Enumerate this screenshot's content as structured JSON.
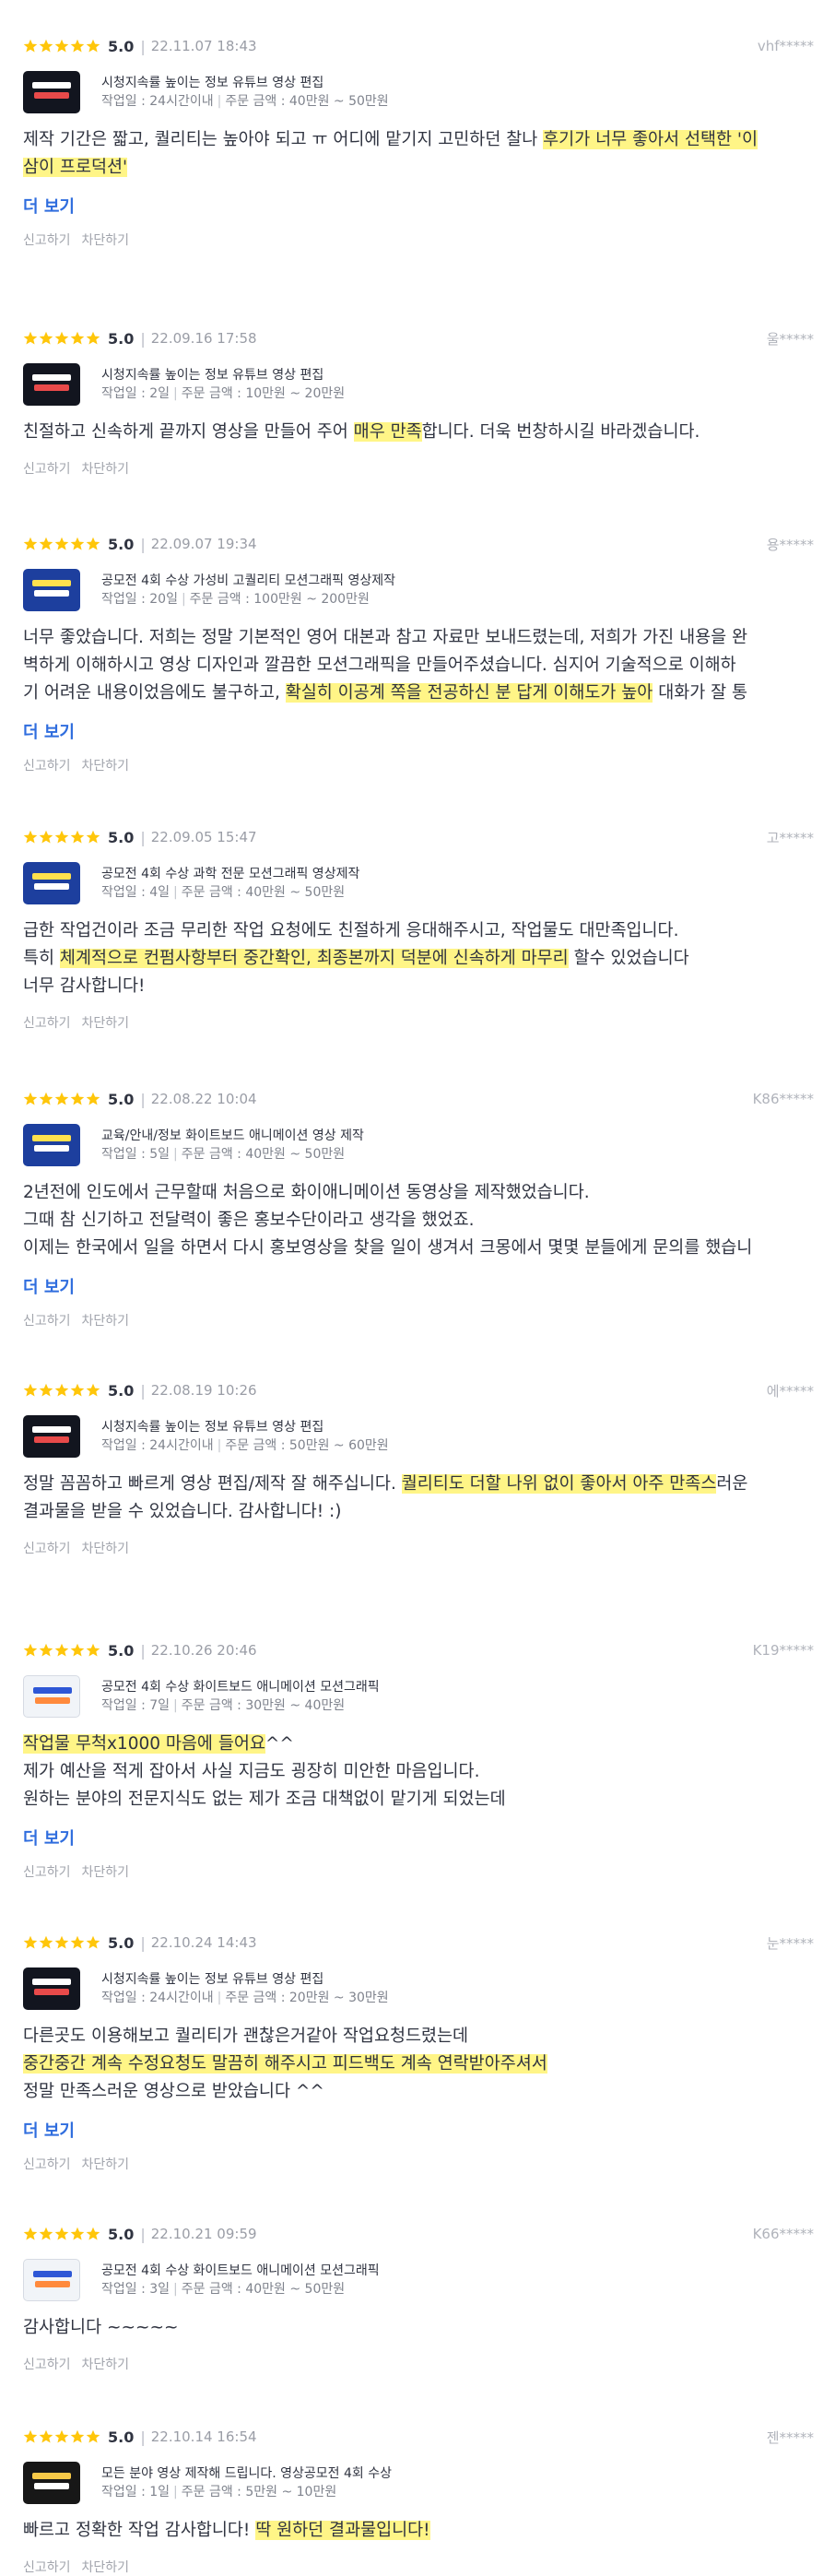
{
  "more_label": "더 보기",
  "report_label": "신고하기",
  "block_label": "차단하기",
  "star_color": "#ffc60a",
  "highlight_color": "#fff587",
  "reviews": [
    {
      "score": "5.0",
      "date": "22.11.07 18:43",
      "user": "vhf*****",
      "gig_title": "시청지속률 높이는 정보 유튜브 영상 편집",
      "work_days": "작업일 : 24시간이내",
      "price": "주문 금액 : 40만원 ~ 50만원",
      "thumb": "dark",
      "has_more": true,
      "lines": [
        [
          {
            "t": "제작 기간은 짧고, 퀄리티는 높아야 되고 ㅠ 어디에 맡기지 고민하던 찰나 "
          },
          {
            "t": "후기가 너무 좋아서 선택한 '이",
            "hl": true
          }
        ],
        [
          {
            "t": "삼이 프로덕션'",
            "hl": true
          }
        ]
      ]
    },
    {
      "score": "5.0",
      "date": "22.09.16 17:58",
      "user": "울*****",
      "gig_title": "시청지속률 높이는 정보 유튜브 영상 편집",
      "work_days": "작업일 : 2일",
      "price": "주문 금액 : 10만원 ~ 20만원",
      "thumb": "dark",
      "has_more": false,
      "lines": [
        [
          {
            "t": "친절하고 신속하게 끝까지 영상을 만들어 주어 "
          },
          {
            "t": "매우 만족",
            "hl": true
          },
          {
            "t": "합니다. 더욱  번창하시길 바라겠습니다."
          }
        ]
      ]
    },
    {
      "score": "5.0",
      "date": "22.09.07 19:34",
      "user": "용*****",
      "gig_title": "공모전 4회 수상 가성비 고퀄리티 모션그래픽 영상제작",
      "work_days": "작업일 : 20일",
      "price": "주문 금액 : 100만원 ~ 200만원",
      "thumb": "blue",
      "has_more": true,
      "lines": [
        [
          {
            "t": "너무 좋았습니다. 저희는 정말 기본적인 영어 대본과 참고 자료만 보내드렸는데, 저희가 가진 내용을 완"
          }
        ],
        [
          {
            "t": "벽하게 이해하시고 영상 디자인과 깔끔한 모션그래픽을 만들어주셨습니다. 심지어 기술적으로 이해하"
          }
        ],
        [
          {
            "t": "기 어려운 내용이었음에도 불구하고, "
          },
          {
            "t": "확실히 이공계 쪽을 전공하신 분 답게 이해도가 높아",
            "hl": true
          },
          {
            "t": " 대화가 잘 통"
          }
        ]
      ]
    },
    {
      "score": "5.0",
      "date": "22.09.05 15:47",
      "user": "고*****",
      "gig_title": "공모전 4회 수상 과학 전문 모션그래픽 영상제작",
      "work_days": "작업일 : 4일",
      "price": "주문 금액 : 40만원 ~ 50만원",
      "thumb": "blue",
      "has_more": false,
      "lines": [
        [
          {
            "t": "급한 작업건이라 조금 무리한 작업 요청에도 친절하게 응대해주시고, 작업물도 대만족입니다."
          }
        ],
        [
          {
            "t": "특히 "
          },
          {
            "t": "체계적으로 컨펌사항부터 중간확인, 최종본까지 덕분에 신속하게 마무리",
            "hl": true
          },
          {
            "t": " 할수 있었습니다"
          }
        ],
        [
          {
            "t": "너무 감사합니다!"
          }
        ]
      ]
    },
    {
      "score": "5.0",
      "date": "22.08.22 10:04",
      "user": "K86*****",
      "gig_title": "교육/안내/정보 화이트보드 애니메이션 영상 제작",
      "work_days": "작업일 : 5일",
      "price": "주문 금액 : 40만원 ~ 50만원",
      "thumb": "blue",
      "has_more": true,
      "lines": [
        [
          {
            "t": "2년전에 인도에서 근무할때 처음으로 화이애니메이션 동영상을 제작했었습니다."
          }
        ],
        [
          {
            "t": "그때 참 신기하고 전달력이 좋은 홍보수단이라고 생각을 했었죠."
          }
        ],
        [
          {
            "t": "이제는 한국에서 일을 하면서 다시 홍보영상을 찾을 일이 생겨서 크몽에서 몇몇 분들에게 문의를 했습니"
          }
        ]
      ]
    },
    {
      "score": "5.0",
      "date": "22.08.19 10:26",
      "user": "에*****",
      "gig_title": "시청지속률 높이는 정보 유튜브 영상 편집",
      "work_days": "작업일 : 24시간이내",
      "price": "주문 금액 : 50만원 ~ 60만원",
      "thumb": "dark",
      "has_more": false,
      "lines": [
        [
          {
            "t": "정말 꼼꼼하고 빠르게 영상 편집/제작 잘 해주십니다. "
          },
          {
            "t": "퀄리티도 더할 나위 없이 좋아서 아주 만족스",
            "hl": true
          },
          {
            "t": "러운"
          }
        ],
        [
          {
            "t": "결과물을 받을 수 있었습니다. 감사합니다! :)"
          }
        ]
      ]
    },
    {
      "score": "5.0",
      "date": "22.10.26 20:46",
      "user": "K19*****",
      "gig_title": "공모전 4회 수상 화이트보드 애니메이션 모션그래픽",
      "work_days": "작업일 : 7일",
      "price": "주문 금액 : 30만원 ~ 40만원",
      "thumb": "wb",
      "has_more": true,
      "lines": [
        [
          {
            "t": "작업물 무척x1000 마음에 들어요",
            "hl": true
          },
          {
            "t": "^^"
          }
        ],
        [
          {
            "t": "제가 예산을 적게 잡아서 사실 지금도 굉장히 미안한 마음입니다."
          }
        ],
        [
          {
            "t": "원하는 분야의 전문지식도 없는 제가 조금 대책없이 맡기게 되었는데"
          }
        ]
      ]
    },
    {
      "score": "5.0",
      "date": "22.10.24 14:43",
      "user": "눈*****",
      "gig_title": "시청지속률 높이는 정보 유튜브 영상 편집",
      "work_days": "작업일 : 24시간이내",
      "price": "주문 금액 : 20만원 ~ 30만원",
      "thumb": "dark",
      "has_more": true,
      "lines": [
        [
          {
            "t": "다른곳도 이용해보고 퀄리티가 괜찮은거같아 작업요청드렸는데"
          }
        ],
        [
          {
            "t": "중간중간 계속 수정요청도 말끔히 해주시고 피드백도 계속 연락받아주셔서",
            "hl": true
          }
        ],
        [
          {
            "t": "정말 만족스러운 영상으로 받았습니다 ^^"
          }
        ]
      ]
    },
    {
      "score": "5.0",
      "date": "22.10.21 09:59",
      "user": "K66*****",
      "gig_title": "공모전 4회 수상 화이트보드 애니메이션 모션그래픽",
      "work_days": "작업일 : 3일",
      "price": "주문 금액 : 40만원 ~ 50만원",
      "thumb": "wb",
      "has_more": false,
      "lines": [
        [
          {
            "t": "감사합니다 ~~~~~"
          }
        ]
      ]
    },
    {
      "score": "5.0",
      "date": "22.10.14 16:54",
      "user": "젠*****",
      "gig_title": "모든 분야 영상 제작해 드립니다. 영상공모전 4회 수상",
      "work_days": "작업일 : 1일",
      "price": "주문 금액 : 5만원 ~ 10만원",
      "thumb": "gold",
      "has_more": false,
      "lines": [
        [
          {
            "t": "빠르고 정확한 작업 감사합니다! "
          },
          {
            "t": "딱 원하던 결과물입니다!",
            "hl": true
          }
        ]
      ]
    }
  ]
}
